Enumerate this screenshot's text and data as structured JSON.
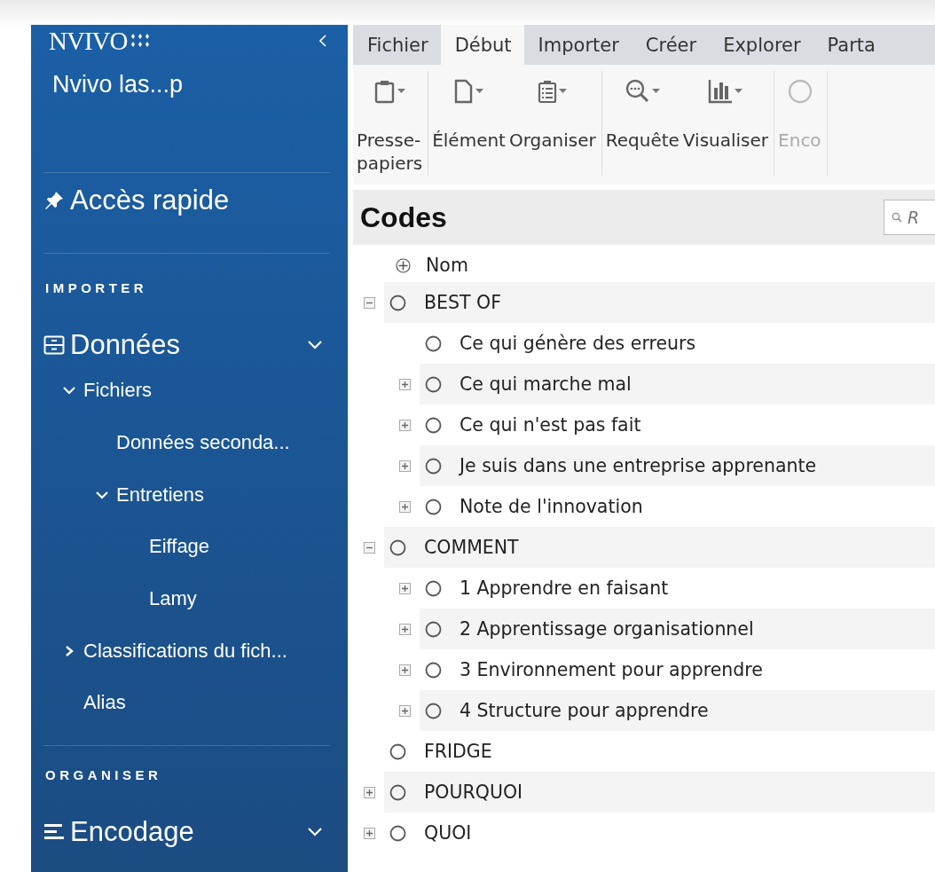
{
  "sidebar": {
    "logo": "NVIVO",
    "project": "Nvivo las...p",
    "quick_access": "Accès rapide",
    "sections": [
      {
        "heading": "IMPORTER",
        "items": [
          {
            "label": "Données",
            "kind": "drawer",
            "expanded": true,
            "children": [
              {
                "label": "Fichiers",
                "expanded": true,
                "children": [
                  {
                    "label": "Données seconda..."
                  },
                  {
                    "label": "Entretiens",
                    "expanded": true,
                    "children": [
                      {
                        "label": "Eiffage"
                      },
                      {
                        "label": "Lamy"
                      }
                    ]
                  }
                ]
              },
              {
                "label": "Classifications du fich...",
                "expanded": false
              },
              {
                "label": "Alias"
              }
            ]
          }
        ]
      },
      {
        "heading": "ORGANISER",
        "items": [
          {
            "label": "Encodage",
            "kind": "lines",
            "expanded": true
          }
        ]
      }
    ]
  },
  "tabs": [
    {
      "label": "Fichier",
      "selected": false
    },
    {
      "label": "Début",
      "selected": true
    },
    {
      "label": "Importer",
      "selected": false
    },
    {
      "label": "Créer",
      "selected": false
    },
    {
      "label": "Explorer",
      "selected": false
    },
    {
      "label": "Parta",
      "selected": false
    }
  ],
  "ribbon_groups": [
    [
      {
        "label": "Presse-\npapiers",
        "kind": "clipboard",
        "disabled": false
      }
    ],
    [
      {
        "label": "Élément",
        "kind": "document",
        "disabled": false
      },
      {
        "label": "Organiser",
        "kind": "list",
        "disabled": false
      }
    ],
    [
      {
        "label": "Requête",
        "kind": "query",
        "disabled": false
      },
      {
        "label": "Visualiser",
        "kind": "chart",
        "disabled": false
      }
    ],
    [
      {
        "label": "Enco",
        "kind": "circle",
        "disabled": true
      }
    ]
  ],
  "panel": {
    "title": "Codes",
    "search": {
      "placeholder": "R"
    },
    "column": "Nom"
  },
  "codes": [
    {
      "name": "BEST OF",
      "expanded": true,
      "children": [
        {
          "name": "Ce qui génère des erreurs"
        },
        {
          "name": "Ce qui marche mal",
          "expanded": false
        },
        {
          "name": "Ce qui n'est pas fait",
          "expanded": false
        },
        {
          "name": "Je suis dans une entreprise apprenante",
          "expanded": false
        },
        {
          "name": "Note de l'innovation",
          "expanded": false
        }
      ]
    },
    {
      "name": "COMMENT",
      "expanded": true,
      "children": [
        {
          "name": "1 Apprendre en faisant",
          "expanded": false
        },
        {
          "name": "2 Apprentissage organisationnel",
          "expanded": false
        },
        {
          "name": "3 Environnement pour apprendre",
          "expanded": false
        },
        {
          "name": "4 Structure pour apprendre",
          "expanded": false
        }
      ]
    },
    {
      "name": "FRIDGE"
    },
    {
      "name": "POURQUOI",
      "expanded": false
    },
    {
      "name": "QUOI",
      "expanded": false
    }
  ]
}
